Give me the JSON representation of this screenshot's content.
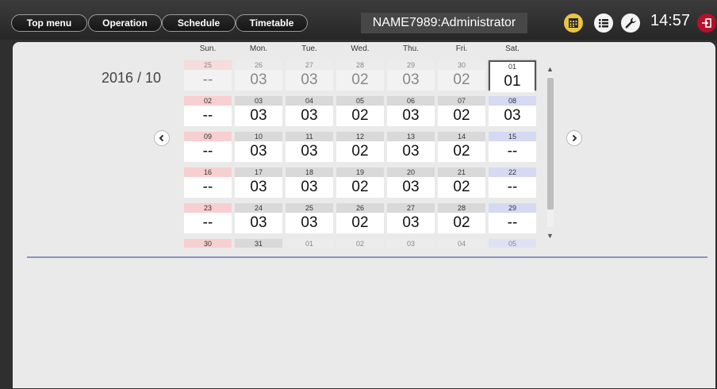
{
  "nav": {
    "top_menu": "Top menu",
    "operation": "Operation",
    "schedule": "Schedule",
    "timetable": "Timetable"
  },
  "user": "NAME7989:Administrator",
  "clock": "14:57",
  "icons": {
    "calendar": "calendar-icon",
    "list": "list-icon",
    "wrench": "wrench-icon",
    "logout": "logout-icon"
  },
  "colors": {
    "calendar_icon": "#e8c545",
    "logout_icon": "#b2122a",
    "sunday_header": "#f7cfd0",
    "saturday_header": "#d6d9f2",
    "divider": "#8f92be"
  },
  "calendar": {
    "month_label": "2016 / 10",
    "day_names": [
      "Sun.",
      "Mon.",
      "Tue.",
      "Wed.",
      "Thu.",
      "Fri.",
      "Sat."
    ],
    "selected_date": "01",
    "weeks": [
      [
        {
          "d": "25",
          "v": "--",
          "o": true
        },
        {
          "d": "26",
          "v": "03",
          "o": true
        },
        {
          "d": "27",
          "v": "03",
          "o": true
        },
        {
          "d": "28",
          "v": "02",
          "o": true
        },
        {
          "d": "29",
          "v": "03",
          "o": true
        },
        {
          "d": "30",
          "v": "02",
          "o": true
        },
        {
          "d": "01",
          "v": "01",
          "sel": true
        }
      ],
      [
        {
          "d": "02",
          "v": "--"
        },
        {
          "d": "03",
          "v": "03"
        },
        {
          "d": "04",
          "v": "03"
        },
        {
          "d": "05",
          "v": "02"
        },
        {
          "d": "06",
          "v": "03"
        },
        {
          "d": "07",
          "v": "02"
        },
        {
          "d": "08",
          "v": "03"
        }
      ],
      [
        {
          "d": "09",
          "v": "--"
        },
        {
          "d": "10",
          "v": "03"
        },
        {
          "d": "11",
          "v": "03"
        },
        {
          "d": "12",
          "v": "02"
        },
        {
          "d": "13",
          "v": "03"
        },
        {
          "d": "14",
          "v": "02"
        },
        {
          "d": "15",
          "v": "--"
        }
      ],
      [
        {
          "d": "16",
          "v": "--"
        },
        {
          "d": "17",
          "v": "03"
        },
        {
          "d": "18",
          "v": "03"
        },
        {
          "d": "19",
          "v": "02"
        },
        {
          "d": "20",
          "v": "03"
        },
        {
          "d": "21",
          "v": "02"
        },
        {
          "d": "22",
          "v": "--"
        }
      ],
      [
        {
          "d": "23",
          "v": "--"
        },
        {
          "d": "24",
          "v": "03"
        },
        {
          "d": "25",
          "v": "03"
        },
        {
          "d": "26",
          "v": "02"
        },
        {
          "d": "27",
          "v": "03"
        },
        {
          "d": "28",
          "v": "02"
        },
        {
          "d": "29",
          "v": "--"
        }
      ],
      [
        {
          "d": "30",
          "v": ""
        },
        {
          "d": "31",
          "v": ""
        },
        {
          "d": "01",
          "v": "",
          "o": true
        },
        {
          "d": "02",
          "v": "",
          "o": true
        },
        {
          "d": "03",
          "v": "",
          "o": true
        },
        {
          "d": "04",
          "v": "",
          "o": true
        },
        {
          "d": "05",
          "v": "",
          "o": true
        }
      ]
    ]
  }
}
